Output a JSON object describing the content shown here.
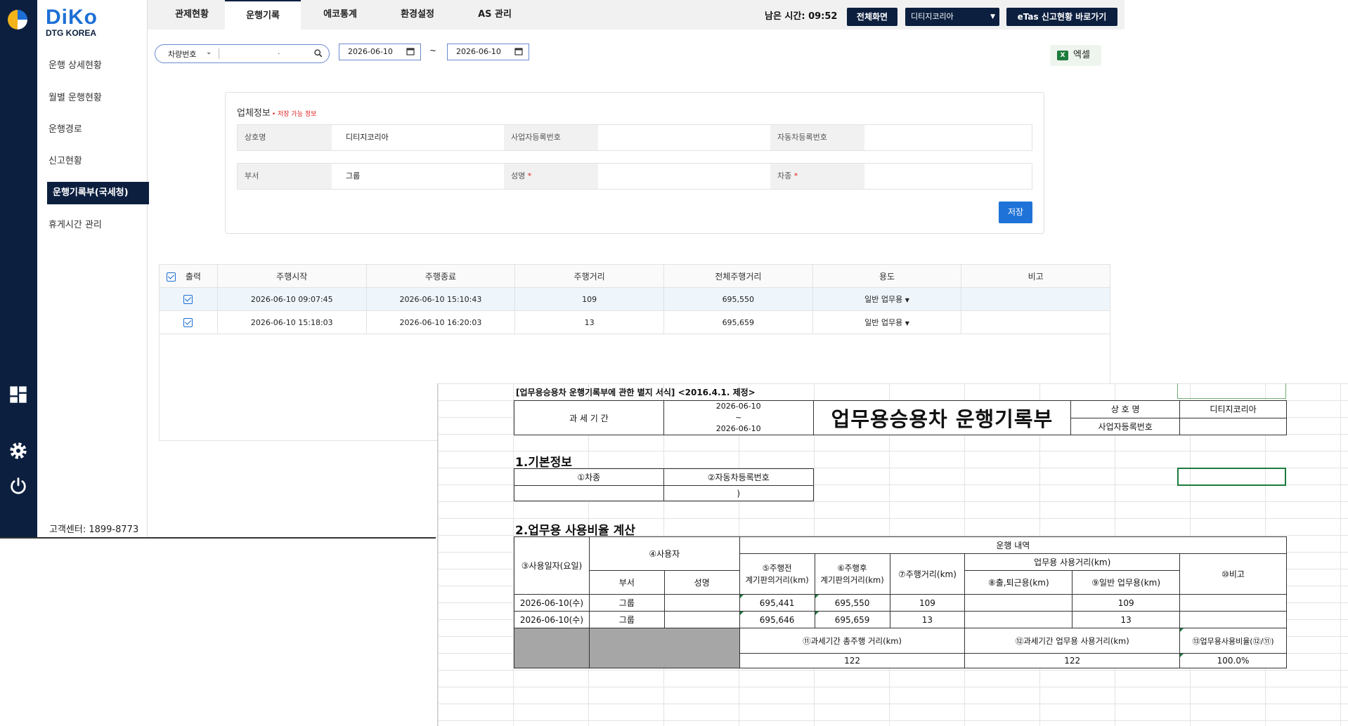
{
  "brand": {
    "name": "DiKo",
    "sub": "DTG KOREA"
  },
  "menu": [
    {
      "label": "운행 상세현황"
    },
    {
      "label": "월별 운행현황"
    },
    {
      "label": "운행경로"
    },
    {
      "label": "신고현황"
    },
    {
      "label": "운행기록부(국세청)",
      "active": true
    },
    {
      "label": "휴게시간 관리"
    }
  ],
  "dark_icons": [
    "dashboard-icon",
    "settings-icon",
    "power-icon"
  ],
  "support": "고객센터: 1899-8773",
  "tabs": [
    {
      "label": "관제현황"
    },
    {
      "label": "운행기록",
      "active": true
    },
    {
      "label": "에코통계"
    },
    {
      "label": "환경설정"
    },
    {
      "label": "AS 관리"
    }
  ],
  "header": {
    "remain_time": "남은 시간: 09:52",
    "full_screen": "전체화면",
    "company_select": "디티지코리아",
    "etas": "eTas 신고현황 바로가기"
  },
  "filter": {
    "vehicle_select": "차량번호",
    "vehicle_input": ".",
    "date_from": "2026-06-10",
    "date_tilde": "~",
    "date_to": "2026-06-10",
    "excel": "엑셀"
  },
  "company_card": {
    "title": "업체정보",
    "note": "• 저장 가능 정보",
    "row1": [
      {
        "label": "상호명",
        "value": "디티지코리아"
      },
      {
        "label": "사업자등록번호",
        "value": ""
      },
      {
        "label": "자동차등록번호",
        "value": ""
      }
    ],
    "row2": [
      {
        "label": "부서",
        "value": "그룹"
      },
      {
        "label": "성명",
        "value": "",
        "required": true
      },
      {
        "label": "차종",
        "value": "",
        "required": true
      }
    ],
    "save": "저장"
  },
  "trip_table": {
    "headers": [
      "출력",
      "주행시작",
      "주행종료",
      "주행거리",
      "전체주행거리",
      "용도",
      "비고"
    ],
    "rows": [
      {
        "start": "2026-06-10 09:07:45",
        "end": "2026-06-10 15:10:43",
        "distance": "109",
        "total": "695,550",
        "purpose": "일반 업무용",
        "note": ""
      },
      {
        "start": "2026-06-10 15:18:03",
        "end": "2026-06-10 16:20:03",
        "distance": "13",
        "total": "695,659",
        "purpose": "일반 업무용",
        "note": ""
      }
    ]
  },
  "sheet": {
    "heading": "[업무용승용차 운행기록부에 관한 별지 서식] <2016.4.1. 제정>",
    "period_label": "과 세 기 간",
    "period_from": "2026-06-10",
    "period_tilde": "~",
    "period_to": "2026-06-10",
    "big_title": "업무용승용차 운행기록부",
    "company_label": "상 호 명",
    "company_value": "디티지코리아",
    "bizno_label": "사업자등록번호",
    "bizno_value": "",
    "section1": "1.기본정보",
    "car_type_label": "①차종",
    "car_no_label": "②자동차등록번호",
    "car_type_value": "",
    "car_no_value": ")",
    "section2": "2.업무용 사용비율 계산",
    "col_date": "③사용일자(요일)",
    "col_user": "④사용자",
    "col_dept": "부서",
    "col_name": "성명",
    "col_drive": "운행 내역",
    "col_before": "⑤주행전\n계기판의거리(km)",
    "col_after": "⑥주행후\n계기판의거리(km)",
    "col_dist": "⑦주행거리(km)",
    "col_business": "업무용 사용거리(km)",
    "col_commute": "⑧출,퇴근용(km)",
    "col_general": "⑨일반 업무용(km)",
    "col_note": "⑩비고",
    "rows": [
      {
        "date": "2026-06-10(수)",
        "dept": "그룹",
        "name": "",
        "before": "695,441",
        "after": "695,550",
        "dist": "109",
        "commute": "",
        "general": "109",
        "note": ""
      },
      {
        "date": "2026-06-10(수)",
        "dept": "그룹",
        "name": "",
        "before": "695,646",
        "after": "695,659",
        "dist": "13",
        "commute": "",
        "general": "13",
        "note": ""
      }
    ],
    "sum_total_label": "⑪과세기간 총주행 거리(km)",
    "sum_business_label": "⑫과세기간 업무용 사용거리(km)",
    "sum_ratio_label": "⑬업무용사용비율(⑫/⑪)",
    "sum_total": "122",
    "sum_business": "122",
    "sum_ratio": "100.0%"
  }
}
